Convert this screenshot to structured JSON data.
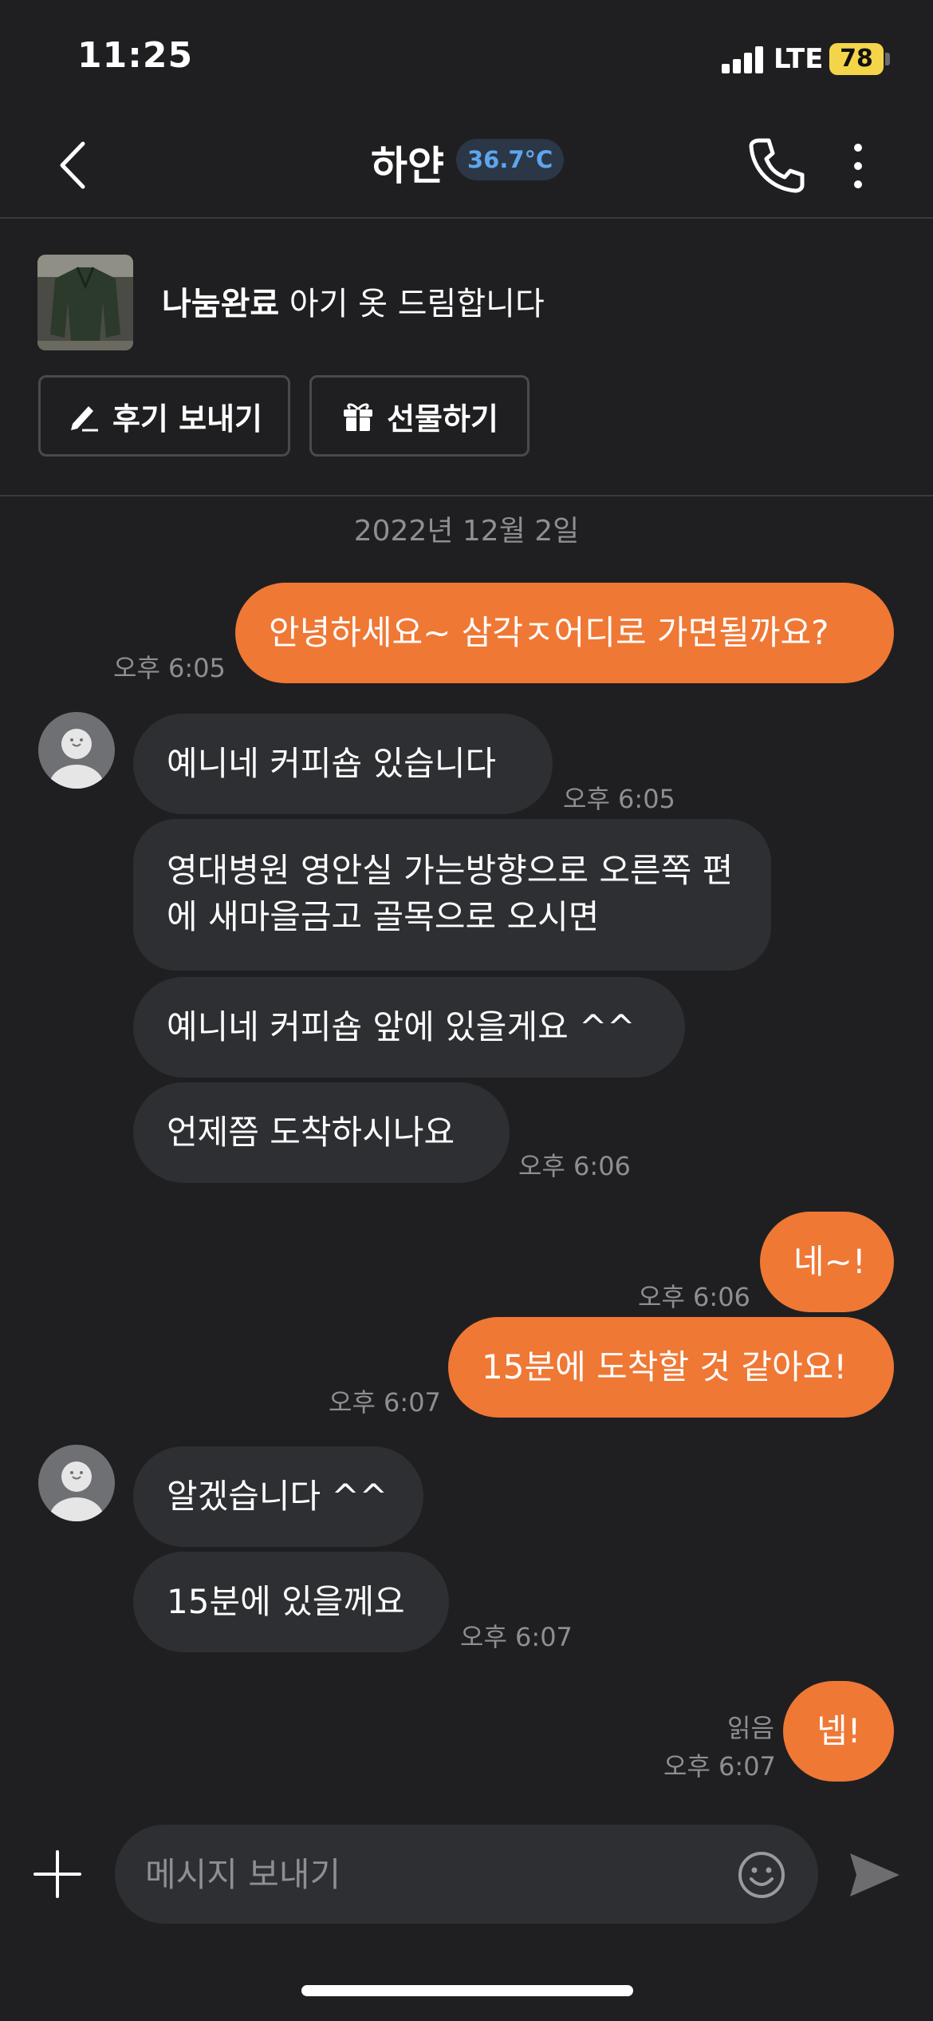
{
  "status_bar": {
    "time": "11:25",
    "network": "LTE",
    "battery": "78"
  },
  "header": {
    "name": "하얀",
    "temperature": "36.7°C"
  },
  "product": {
    "status": "나눔완료",
    "title": "아기 옷 드림합니다"
  },
  "actions": {
    "review": "후기 보내기",
    "gift": "선물하기"
  },
  "chat": {
    "date": "2022년 12월 2일",
    "messages": [
      {
        "side": "out",
        "text": "안녕하세요~ 삼각ㅈ어디로 가면될까요?",
        "time": "오후 6:05"
      },
      {
        "side": "in",
        "text": "예니네 커피숍 있습니다",
        "time": "오후 6:05"
      },
      {
        "side": "in",
        "text": "영대병원 영안실 가는방향으로 오른쪽 편에 새마을금고 골목으로 오시면"
      },
      {
        "side": "in",
        "text": "예니네 커피숍 앞에 있을게요 ^^"
      },
      {
        "side": "in",
        "text": "언제쯤 도착하시나요",
        "time": "오후 6:06"
      },
      {
        "side": "out",
        "text": "네~!",
        "time": "오후 6:06"
      },
      {
        "side": "out",
        "text": "15분에 도착할 것 같아요!",
        "time": "오후 6:07"
      },
      {
        "side": "in",
        "text": "알겠습니다 ^^"
      },
      {
        "side": "in",
        "text": "15분에 있을께요",
        "time": "오후 6:07"
      },
      {
        "side": "out",
        "text": "넵!",
        "time": "오후 6:07",
        "read": "읽음"
      }
    ]
  },
  "input": {
    "placeholder": "메시지 보내기"
  },
  "colors": {
    "background": "#1f1f21",
    "outgoing_bubble": "#ef7835",
    "incoming_bubble": "#2e2f33",
    "temperature": "#5ea6ec",
    "battery": "#f4d54a"
  }
}
